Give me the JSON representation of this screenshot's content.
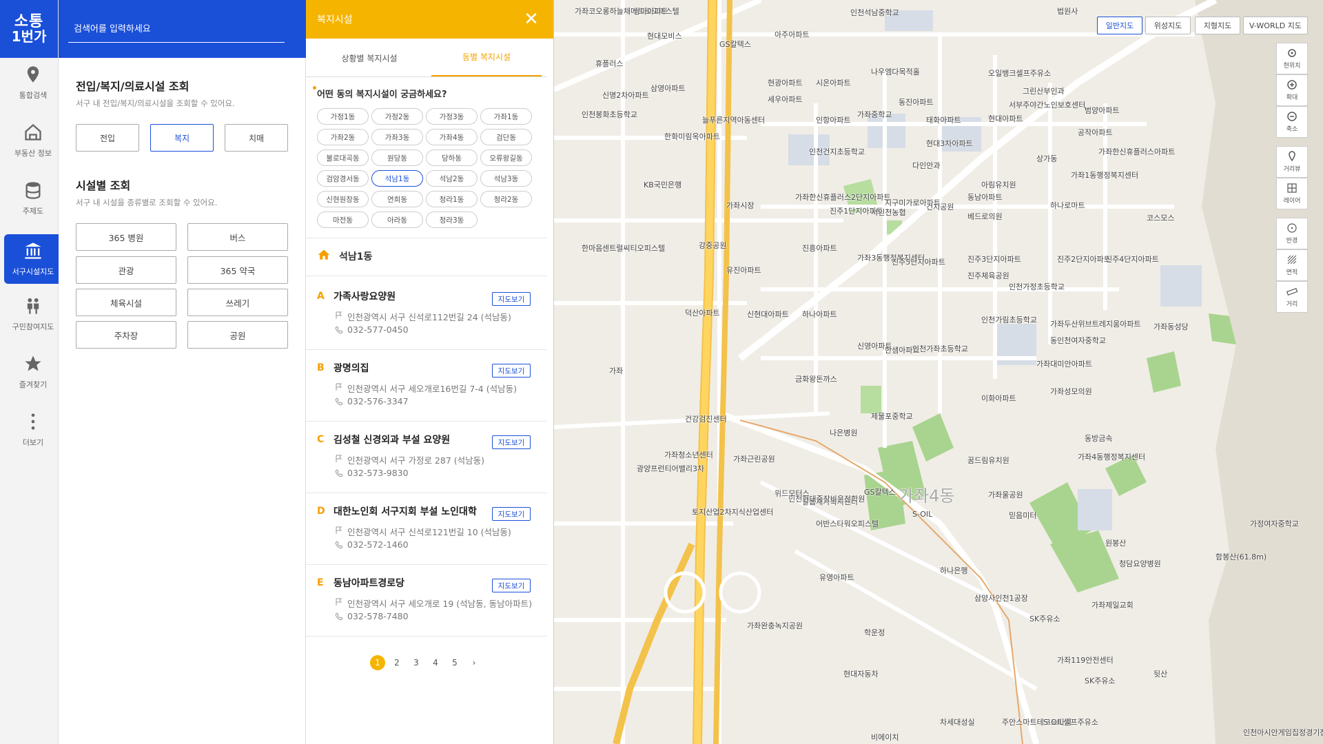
{
  "logo": {
    "line1": "소통",
    "line2": "1번가"
  },
  "nav": [
    {
      "label": "통합검색",
      "icon": "location-pin-icon"
    },
    {
      "label": "부동산 정보",
      "icon": "house-icon"
    },
    {
      "label": "주제도",
      "icon": "database-icon"
    },
    {
      "label": "서구시설지도",
      "icon": "institution-icon"
    },
    {
      "label": "구민참여지도",
      "icon": "people-icon"
    },
    {
      "label": "즐겨찾기",
      "icon": "star-icon"
    },
    {
      "label": "더보기",
      "icon": "more-icon"
    }
  ],
  "search": {
    "placeholder": "검색어를 입력하세요"
  },
  "facility_query": {
    "title": "전입/복지/의료시설 조회",
    "subtitle": "서구 내 전입/복지/의료시설을 조회할 수 있어요.",
    "categories": [
      "전입",
      "복지",
      "치매"
    ],
    "active_category": "복지",
    "type_title": "시설별 조회",
    "type_subtitle": "서구 내 시설을 종류별로 조회할 수 있어요.",
    "types": [
      "365 병원",
      "버스",
      "관광",
      "365 약국",
      "체육시설",
      "쓰레기",
      "주차장",
      "공원"
    ]
  },
  "welfare": {
    "header": "복지시설",
    "close": "✕",
    "tabs": [
      "상황별 복지시설",
      "동별 복지시설"
    ],
    "active_tab": "동별 복지시설",
    "question": "어떤 동의 복지시설이 궁금하세요?",
    "dongs": [
      "가정1동",
      "가정2동",
      "가정3동",
      "가좌1동",
      "가좌2동",
      "가좌3동",
      "가좌4동",
      "검단동",
      "불로대곡동",
      "원당동",
      "당하동",
      "오류왕길동",
      "검암경서동",
      "석남1동",
      "석남2동",
      "석남3동",
      "신현원창동",
      "연희동",
      "청라1동",
      "청라2동",
      "마전동",
      "아라동",
      "청라3동"
    ],
    "selected_dong": "석남1동",
    "facilities": [
      {
        "letter": "A",
        "name": "가족사랑요양원",
        "map_btn": "지도보기",
        "address": "인천광역시 서구 신석로112번길 24 (석남동)",
        "phone": "032-577-0450"
      },
      {
        "letter": "B",
        "name": "광명의집",
        "map_btn": "지도보기",
        "address": "인천광역시 서구 세오개로16번길 7-4 (석남동)",
        "phone": "032-576-3347"
      },
      {
        "letter": "C",
        "name": "김성철 신경외과 부설 요양원",
        "map_btn": "지도보기",
        "address": "인천광역시 서구 가정로 287 (석남동)",
        "phone": "032-573-9830"
      },
      {
        "letter": "D",
        "name": "대한노인회 서구지회 부설 노인대학",
        "map_btn": "지도보기",
        "address": "인천광역시 서구 신석로121번길 10 (석남동)",
        "phone": "032-572-1460"
      },
      {
        "letter": "E",
        "name": "동남아파트경로당",
        "map_btn": "지도보기",
        "address": "인천광역시 서구 세오개로 19 (석남동, 동남아파트)",
        "phone": "032-578-7480"
      }
    ],
    "pages": [
      "1",
      "2",
      "3",
      "4",
      "5",
      "›"
    ],
    "current_page": "1"
  },
  "map": {
    "types": [
      "일반지도",
      "위성지도",
      "지형지도",
      "V-WORLD 지도"
    ],
    "active_type": "일반지도",
    "tools": [
      {
        "label": "현위치",
        "icon": "crosshair-icon"
      },
      {
        "label": "확대",
        "icon": "zoom-in-icon"
      },
      {
        "label": "축소",
        "icon": "zoom-out-icon"
      },
      {
        "label": "거리뷰",
        "icon": "street-view-icon"
      },
      {
        "label": "레이어",
        "icon": "layers-icon"
      },
      {
        "label": "반경",
        "icon": "radius-icon"
      },
      {
        "label": "면적",
        "icon": "area-icon"
      },
      {
        "label": "거리",
        "icon": "ruler-icon"
      }
    ],
    "labels": [
      "가좌코오롱하늘채메트로오피스텔",
      "쌍마아파트",
      "현대모비스",
      "GS칼텍스",
      "아주아파트",
      "인천석남중학교",
      "법원사",
      "휴플러스",
      "현광아파트",
      "시온아파트",
      "나우엠다목적홀",
      "오일뱅크셀프주유소",
      "그린산부인과",
      "신명2차아파트",
      "삼영아파트",
      "세우아파트",
      "동진아파트",
      "서부주야간노인보호센터",
      "범양아파트",
      "늘푸른지역아동센터",
      "인천봉화초등학교",
      "인항아파트",
      "가좌중학교",
      "태화아파트",
      "현대아파트",
      "공작아파트",
      "한화미림옥아파트",
      "인천건지초등학교",
      "현대3차아파트",
      "다인안과",
      "가좌한신휴플러스아파트",
      "상가동",
      "아림유치원",
      "가좌1동행정복지센터",
      "KB국민은행",
      "가좌시장",
      "가좌한신휴플러스2단지아파트",
      "지구미가로아파트",
      "동남아파트",
      "진주1단지아파트",
      "서인천농협",
      "건지공원",
      "베드로의원",
      "하나로마트",
      "코스모스",
      "센트럴씨티오피스텔",
      "강중공원",
      "진흥아파트",
      "가좌3동행정복지센터",
      "진주3단지아파트",
      "진주2단지아파트",
      "한마음",
      "유진아파트",
      "진주5단지아파트",
      "진주체육공원",
      "진주4단지아파트",
      "인천가정초등학교",
      "덕산아파트",
      "신현대아파트",
      "하나아파트",
      "신영아파트",
      "한샘아파트",
      "인천가림초등학교",
      "가좌동성당",
      "인천가좌초등학교",
      "가좌두산위브트레지움아파트",
      "동인천여자중학교",
      "건강검진센터",
      "나은병원",
      "제물포중학교",
      "이화아파트",
      "가좌대미안아파트",
      "가좌성모의원",
      "금화왕돈까스",
      "가좌청소년센터",
      "가좌근린공원",
      "꿈드림유치원",
      "동방금속",
      "광양프런티어밸리3차",
      "살롬재가복지센터",
      "토지산업2차지식산업센터",
      "인천현대중장비운전학원",
      "가좌4동행정복지센터",
      "가좌울공원",
      "위드모터스",
      "GS칼텍스",
      "S-OIL",
      "가좌4동",
      "믿음미터",
      "어반스타워오피스텔",
      "가정여자중학교",
      "함봉산(61.8m)",
      "유영아파트",
      "삼양사인천1공장",
      "가좌제일교회",
      "가좌완충녹지공원",
      "하나은행",
      "SK주유소",
      "청담요양병원",
      "학운정",
      "가좌119안전센터",
      "현대자동차",
      "SK주유소",
      "뒷산",
      "차세대성실",
      "주안스마트테크노타워",
      "S-OIL셀프주유소",
      "인천아시안게임집정경기장",
      "비에이치",
      "가좌",
      "원봉산"
    ]
  }
}
